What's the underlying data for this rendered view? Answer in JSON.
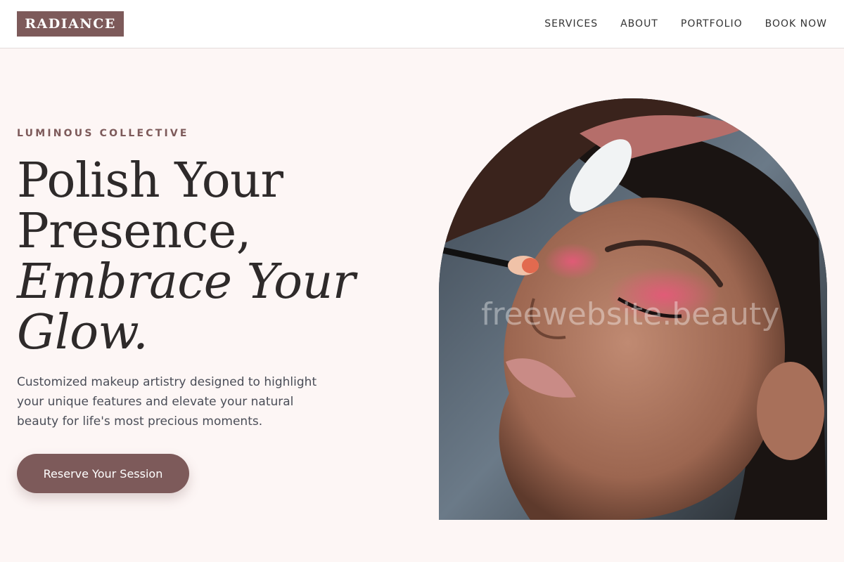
{
  "header": {
    "logo": "RADIANCE",
    "nav": [
      "SERVICES",
      "ABOUT",
      "PORTFOLIO",
      "BOOK NOW"
    ]
  },
  "hero": {
    "eyebrow": "LUMINOUS COLLECTIVE",
    "headline": {
      "line1": "Polish Your",
      "line2": "Presence,",
      "line3": "Embrace Your",
      "line4": "Glow."
    },
    "description": "Customized makeup artistry designed to highlight your unique features and elevate your natural beauty for life's most precious moments.",
    "cta_label": "Reserve Your Session"
  },
  "image": {
    "watermark": "freewebsite.beauty",
    "description": "makeup-artist-applying-eyeshadow-photo"
  },
  "colors": {
    "accent": "#7d5a5a",
    "background": "#fdf6f5",
    "header_bg": "#ffffff",
    "text": "#2e2a2a"
  }
}
